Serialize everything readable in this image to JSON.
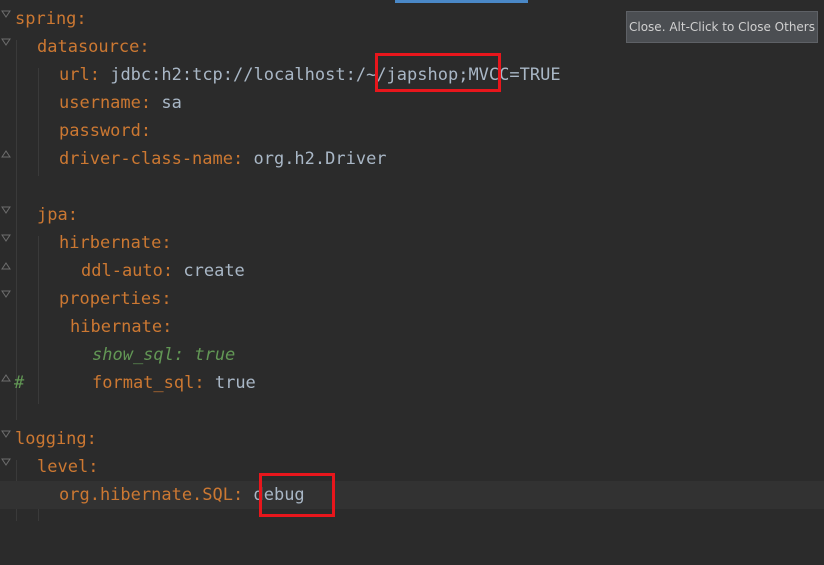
{
  "tooltip": {
    "text": "Close. Alt-Click to Close Others"
  },
  "code": {
    "spring": "spring",
    "datasource": "datasource",
    "url_key": "url",
    "url_prefix": "jdbc:h2:tcp://localhost:",
    "url_path": "/~/japshop;",
    "url_suffix": "MVCC=TRUE",
    "username_key": "username",
    "username_val": "sa",
    "password_key": "password",
    "driver_key": "driver-class-name",
    "driver_val": "org.h2.Driver",
    "jpa": "jpa",
    "hirbernate": "hirbernate",
    "ddl_key": "ddl-auto",
    "ddl_val": "create",
    "properties": "properties",
    "hibernate": "hibernate",
    "comment_mark": "#",
    "show_sql": "show_sql: true",
    "format_key": "format_sql",
    "format_val": "true",
    "logging": "logging",
    "level": "level",
    "sql_key": "org.hibernate.SQL",
    "sql_val": "debug"
  },
  "colors": {
    "background": "#2b2b2b",
    "key": "#cc7832",
    "value": "#a9b7c6",
    "comment": "#629755",
    "highlight": "#e8161c"
  }
}
